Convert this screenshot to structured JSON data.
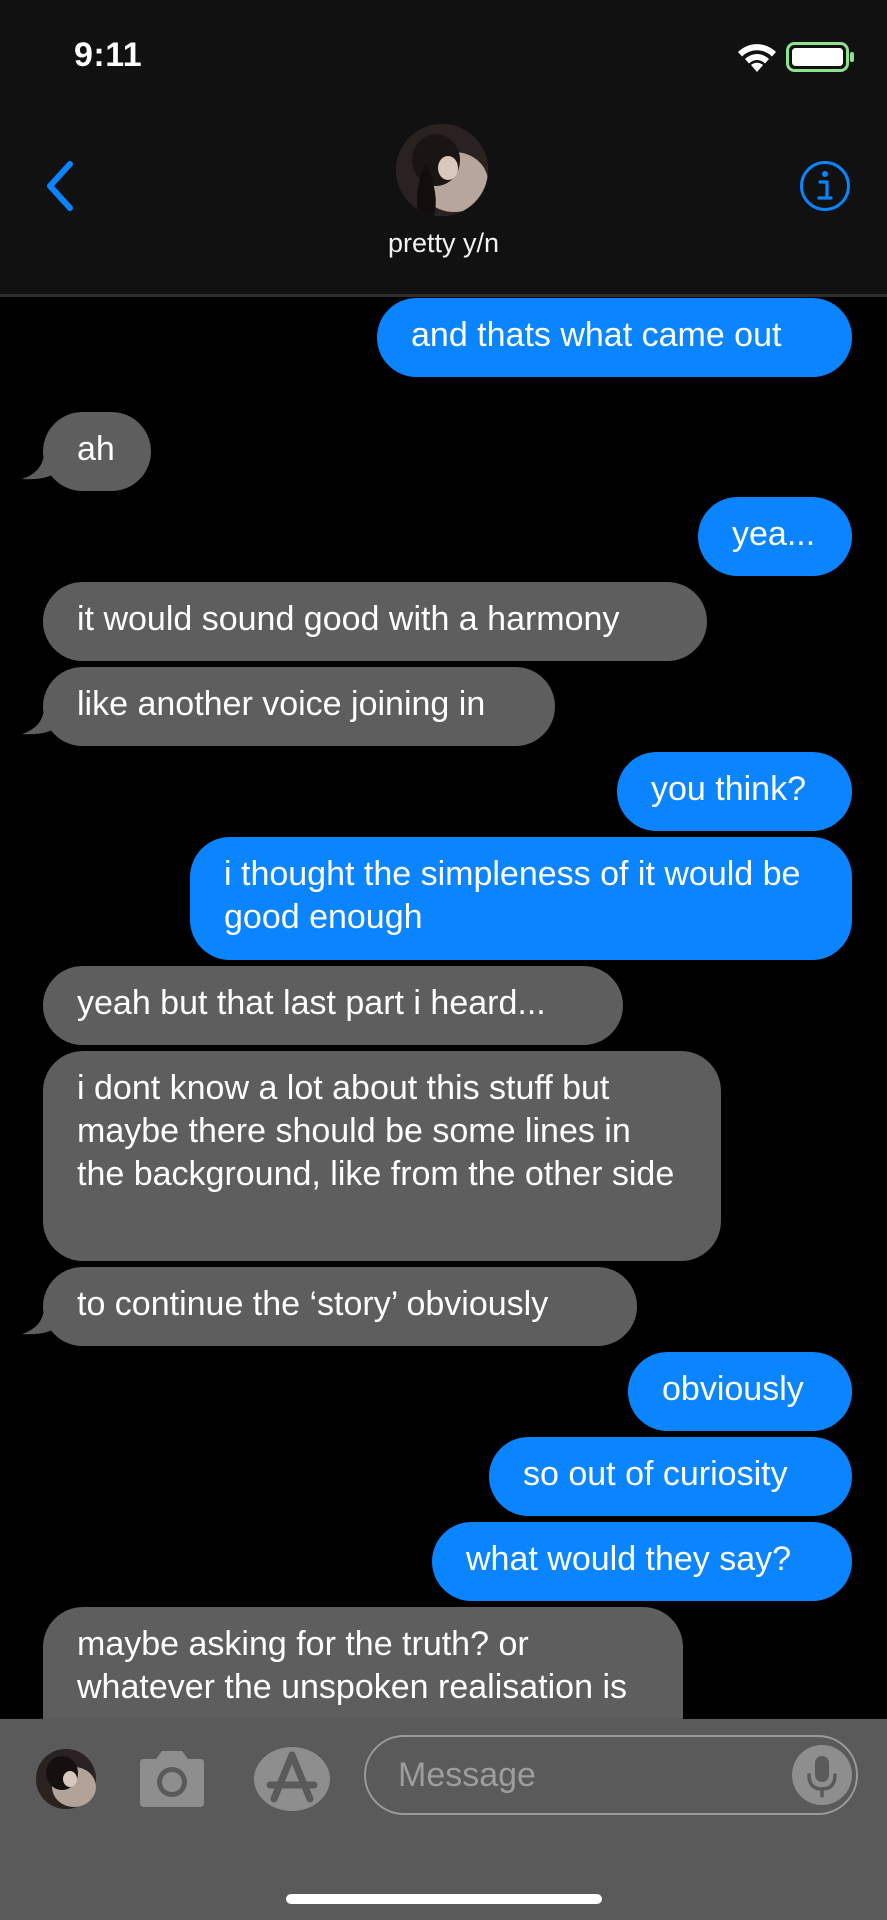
{
  "status_bar": {
    "time": "9:11"
  },
  "header": {
    "contact_name": "pretty y/n",
    "back_icon": "chevron-left-icon",
    "info_icon": "info-circle-icon"
  },
  "colors": {
    "sent_bubble": "#0a84ff",
    "received_bubble": "#5e5e5e",
    "accent": "#0a84ff"
  },
  "messages": [
    {
      "direction": "sent",
      "text": "and thats what came out"
    },
    {
      "direction": "received",
      "text": "ah"
    },
    {
      "direction": "sent",
      "text": "yea..."
    },
    {
      "direction": "received",
      "text": "it would sound good with a harmony"
    },
    {
      "direction": "received",
      "text": "like another voice joining in"
    },
    {
      "direction": "sent",
      "text": "you think?"
    },
    {
      "direction": "sent",
      "text": "i thought the simpleness of it would be good enough"
    },
    {
      "direction": "received",
      "text": "yeah but that last part i heard..."
    },
    {
      "direction": "received",
      "text": "i dont know a lot about this stuff but maybe there should be some lines in the background, like from the other side"
    },
    {
      "direction": "received",
      "text": "to continue the ‘story’ obviously"
    },
    {
      "direction": "sent",
      "text": "obviously"
    },
    {
      "direction": "sent",
      "text": "so out of curiosity"
    },
    {
      "direction": "sent",
      "text": "what would they say?"
    },
    {
      "direction": "received",
      "text": "maybe asking for the truth? or whatever the unspoken realisation is"
    }
  ],
  "input_bar": {
    "placeholder": "Message",
    "camera_icon": "camera-icon",
    "appstore_icon": "app-store-icon",
    "mic_icon": "microphone-icon"
  }
}
